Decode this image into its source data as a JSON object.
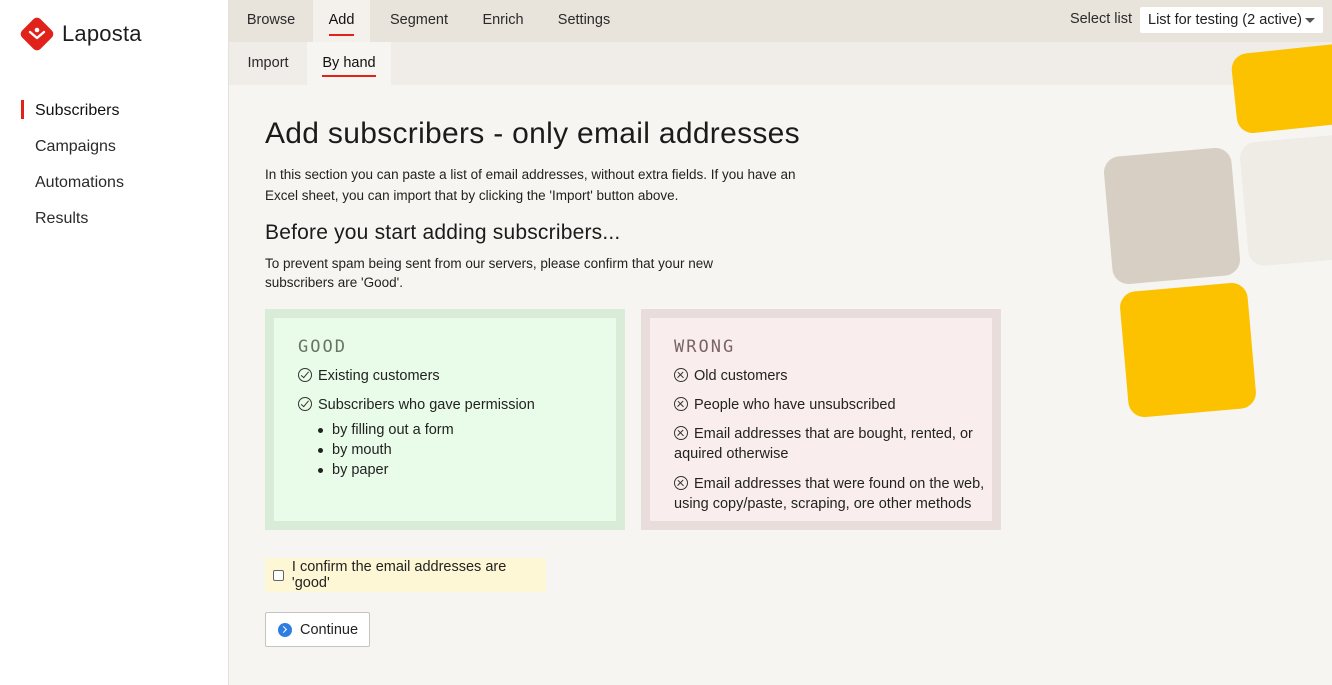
{
  "brand": {
    "name": "Laposta",
    "accent": "#e0221b"
  },
  "sidebar": {
    "items": [
      {
        "label": "Subscribers",
        "active": true
      },
      {
        "label": "Campaigns"
      },
      {
        "label": "Automations"
      },
      {
        "label": "Results"
      }
    ]
  },
  "topnav": {
    "tabs": [
      {
        "label": "Browse"
      },
      {
        "label": "Add",
        "active": true
      },
      {
        "label": "Segment"
      },
      {
        "label": "Enrich"
      },
      {
        "label": "Settings"
      }
    ],
    "select_label": "Select list",
    "selected_list": "List for testing (2 active)"
  },
  "subnav": {
    "tabs": [
      {
        "label": "Import"
      },
      {
        "label": "By hand",
        "active": true
      }
    ]
  },
  "main": {
    "title": "Add subscribers - only email addresses",
    "intro": "In this section you can paste a list of email addresses, without extra fields. If you have an Excel sheet, you can import that by clicking the 'Import' button above.",
    "subtitle": "Before you start adding subscribers...",
    "prevent": "To prevent spam being sent from our servers, please confirm that your new subscribers are 'Good'.",
    "good": {
      "title": "GOOD",
      "items": [
        "Existing customers",
        "Subscribers who gave permission"
      ],
      "sub_items": [
        "by filling out a form",
        "by mouth",
        "by paper"
      ]
    },
    "wrong": {
      "title": "WRONG",
      "items": [
        "Old customers",
        "People who have unsubscribed",
        "Email addresses that are bought, rented, or aquired otherwise",
        "Email addresses that were found on the web, using copy/paste, scraping, ore other methods"
      ]
    },
    "confirm_label": "I confirm the email addresses are 'good'",
    "continue_label": "Continue"
  }
}
